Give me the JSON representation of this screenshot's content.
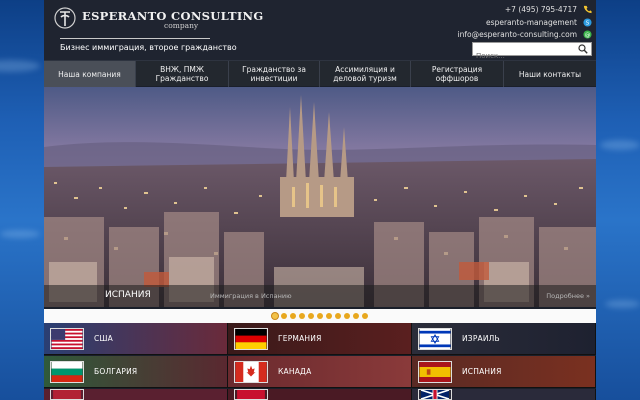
{
  "brand": {
    "title": "ESPERANTO CONSULTING",
    "subtitle": "company",
    "tagline": "Бизнес иммиграция, второе гражданство"
  },
  "contacts": {
    "phone": "+7 (495) 795-4717",
    "skype": "esperanto-management",
    "email": "info@esperanto-consulting.com"
  },
  "search": {
    "placeholder": "Поиск..."
  },
  "nav": {
    "items": [
      {
        "label": "Наша компания",
        "active": true
      },
      {
        "label": "ВНЖ, ПМЖ Гражданство"
      },
      {
        "label": "Гражданство за инвестиции"
      },
      {
        "label": "Ассимиляция и деловой туризм"
      },
      {
        "label": "Регистрация оффшоров"
      },
      {
        "label": "Наши контакты"
      }
    ]
  },
  "slider": {
    "country": "ИСПАНИЯ",
    "link": "Иммиграция в Испанию",
    "more": "Подробнее »",
    "dots_total": 11,
    "active_dot": 0
  },
  "countries": [
    {
      "name": "США",
      "flag": "usa-flag-icon"
    },
    {
      "name": "ГЕРМАНИЯ",
      "flag": "germany-flag-icon"
    },
    {
      "name": "ИЗРАИЛЬ",
      "flag": "israel-flag-icon"
    },
    {
      "name": "БОЛГАРИЯ",
      "flag": "bulgaria-flag-icon"
    },
    {
      "name": "КАНАДА",
      "flag": "canada-flag-icon"
    },
    {
      "name": "ИСПАНИЯ",
      "flag": "spain-flag-icon"
    }
  ],
  "colors": {
    "header_bg": "#1f2430",
    "nav_bg": "#23282f",
    "nav_active": "#4a4f58",
    "dot": "#e8a81f",
    "page_bg": "#1e5fb4"
  }
}
